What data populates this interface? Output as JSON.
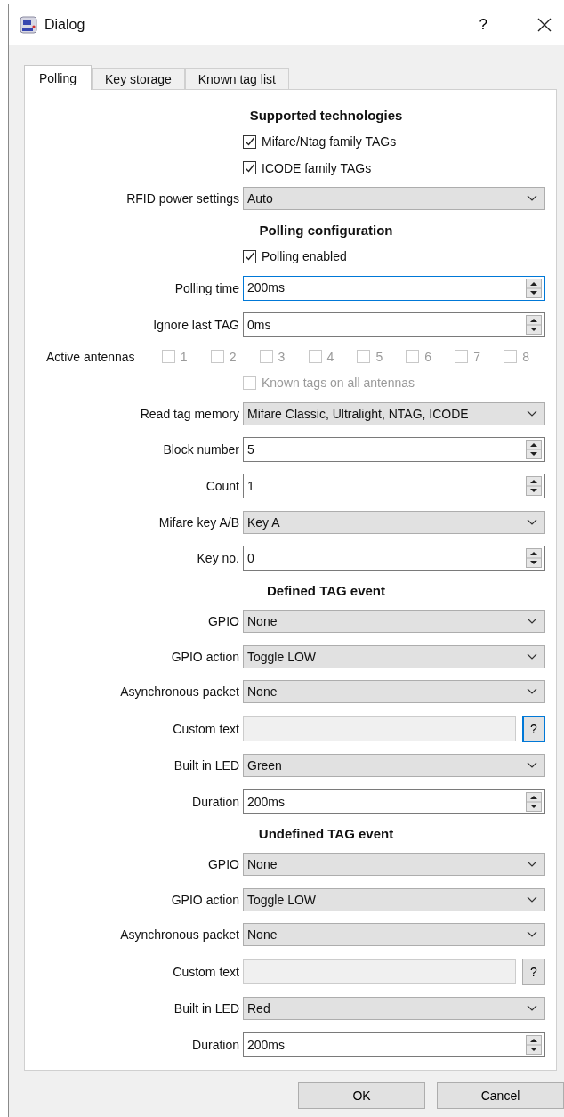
{
  "window": {
    "title": "Dialog",
    "help_label": "?"
  },
  "tabs": [
    {
      "label": "Polling",
      "selected": true
    },
    {
      "label": "Key storage",
      "selected": false
    },
    {
      "label": "Known tag list",
      "selected": false
    }
  ],
  "sections": [
    {
      "heading": "Supported technologies",
      "rows": [
        {
          "kind": "checkbox",
          "label": "Mifare/Ntag family TAGs",
          "checked": true,
          "disabled": false
        },
        {
          "kind": "checkbox",
          "label": "ICODE family TAGs",
          "checked": true,
          "disabled": false
        },
        {
          "kind": "combo",
          "label": "RFID power settings",
          "value": "Auto"
        }
      ]
    },
    {
      "heading": "Polling configuration",
      "rows": [
        {
          "kind": "checkbox",
          "label": "Polling enabled",
          "checked": true,
          "disabled": false
        },
        {
          "kind": "spin",
          "label": "Polling time",
          "value": "200ms",
          "focused": true
        },
        {
          "kind": "spin",
          "label": "Ignore last TAG",
          "value": "0ms",
          "focused": false
        },
        {
          "kind": "antennas",
          "label": "Active antennas",
          "antennas": [
            {
              "label": "1",
              "checked": false,
              "disabled": true
            },
            {
              "label": "2",
              "checked": false,
              "disabled": true
            },
            {
              "label": "3",
              "checked": false,
              "disabled": true
            },
            {
              "label": "4",
              "checked": false,
              "disabled": true
            },
            {
              "label": "5",
              "checked": false,
              "disabled": true
            },
            {
              "label": "6",
              "checked": false,
              "disabled": true
            },
            {
              "label": "7",
              "checked": false,
              "disabled": true
            },
            {
              "label": "8",
              "checked": false,
              "disabled": true
            }
          ]
        },
        {
          "kind": "checkbox",
          "label": "Known tags on all antennas",
          "checked": false,
          "disabled": true
        },
        {
          "kind": "combo",
          "label": "Read tag memory",
          "value": "Mifare Classic, Ultralight, NTAG, ICODE"
        },
        {
          "kind": "spin",
          "label": "Block number",
          "value": "5",
          "focused": false
        },
        {
          "kind": "spin",
          "label": "Count",
          "value": "1",
          "focused": false
        },
        {
          "kind": "combo",
          "label": "Mifare key A/B",
          "value": "Key A"
        },
        {
          "kind": "spin",
          "label": "Key no.",
          "value": "0",
          "focused": false
        }
      ]
    },
    {
      "heading": "Defined TAG event",
      "rows": [
        {
          "kind": "combo",
          "label": "GPIO",
          "value": "None"
        },
        {
          "kind": "combo",
          "label": "GPIO action",
          "value": "Toggle LOW"
        },
        {
          "kind": "combo",
          "label": "Asynchronous packet",
          "value": "None"
        },
        {
          "kind": "text",
          "label": "Custom text",
          "disabled": true,
          "button": "?",
          "button_focused": true
        },
        {
          "kind": "combo",
          "label": "Built in LED",
          "value": "Green"
        },
        {
          "kind": "spin",
          "label": "Duration",
          "value": "200ms",
          "focused": false
        }
      ]
    },
    {
      "heading": "Undefined TAG event",
      "rows": [
        {
          "kind": "combo",
          "label": "GPIO",
          "value": "None"
        },
        {
          "kind": "combo",
          "label": "GPIO action",
          "value": "Toggle LOW"
        },
        {
          "kind": "combo",
          "label": "Asynchronous packet",
          "value": "None"
        },
        {
          "kind": "text",
          "label": "Custom text",
          "disabled": true,
          "button": "?",
          "button_focused": false
        },
        {
          "kind": "combo",
          "label": "Built in LED",
          "value": "Red"
        },
        {
          "kind": "spin",
          "label": "Duration",
          "value": "200ms",
          "focused": false
        }
      ]
    }
  ],
  "buttons": [
    {
      "label": "OK"
    },
    {
      "label": "Cancel"
    }
  ]
}
